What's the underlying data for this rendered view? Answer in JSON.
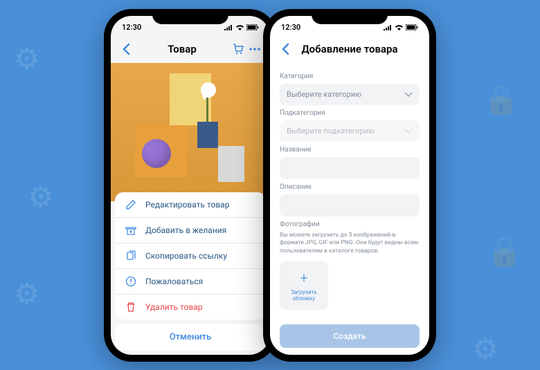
{
  "status": {
    "time": "12:30"
  },
  "left": {
    "title": "Товар",
    "actions": {
      "edit": "Редактировать товар",
      "wishlist": "Добавить в желания",
      "copy": "Скопировать ссылку",
      "report": "Пожаловаться",
      "delete": "Удалить товар"
    },
    "cancel": "Отменить"
  },
  "right": {
    "title": "Добавление товара",
    "category_label": "Категория",
    "category_placeholder": "Выберите категорию",
    "subcategory_label": "Подкатегория",
    "subcategory_placeholder": "Выберите подкатегорию",
    "name_label": "Название",
    "description_label": "Описание",
    "photos_label": "Фотографии",
    "photos_hint": "Вы можете загрузить до 5 изображений в формате JPG, GIF или PNG. Они будут видны всем пользователям в каталоге товаров.",
    "upload": "Загрузить обложку",
    "create": "Создать"
  }
}
